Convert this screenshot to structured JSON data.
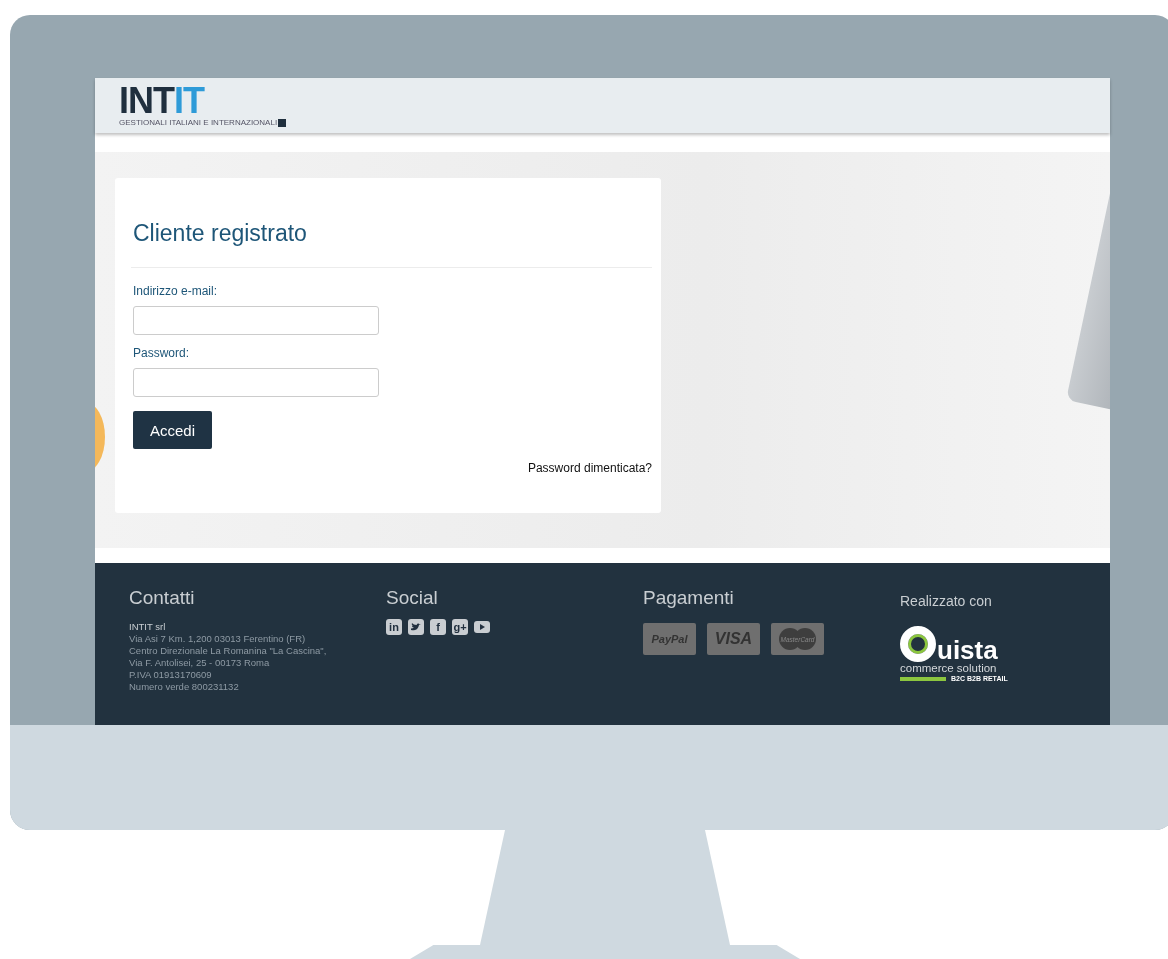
{
  "header": {
    "logo_parts": [
      "INT",
      "IT"
    ],
    "logo_tagline": "GESTIONALI ITALIANI E INTERNAZIONALI"
  },
  "login": {
    "title": "Cliente registrato",
    "fields": [
      {
        "label": "Indirizzo e-mail:"
      },
      {
        "label": "Password:"
      }
    ],
    "submit": "Accedi",
    "forgot_link": "Password dimenticata?"
  },
  "footer": {
    "contacts": {
      "heading": "Contatti",
      "company": "INTIT srl",
      "lines": [
        "Via Asi 7 Km. 1,200 03013 Ferentino (FR)",
        "Centro Direzionale La Romanina \"La Cascina\",",
        "Via F. Antolisei, 25 - 00173 Roma",
        "P.IVA 01913170609",
        "Numero verde 800231132"
      ]
    },
    "social": {
      "heading": "Social",
      "links": [
        {
          "kind": "glyph",
          "glyph": "in"
        },
        {
          "kind": "bird"
        },
        {
          "kind": "glyph",
          "glyph": "f"
        },
        {
          "kind": "glyph",
          "glyph": "g+"
        },
        {
          "kind": "play"
        }
      ]
    },
    "payments": {
      "heading": "Pagamenti",
      "methods": [
        {
          "kind": "paypal",
          "label": "PayPal"
        },
        {
          "kind": "visa",
          "label": "VISA"
        },
        {
          "kind": "mastercard",
          "label": "MasterCard"
        }
      ]
    },
    "made_with": {
      "heading": "Realizzato con",
      "brand": "uista",
      "tagline": "commerce solution",
      "segments": "B2C B2B RETAIL"
    }
  }
}
